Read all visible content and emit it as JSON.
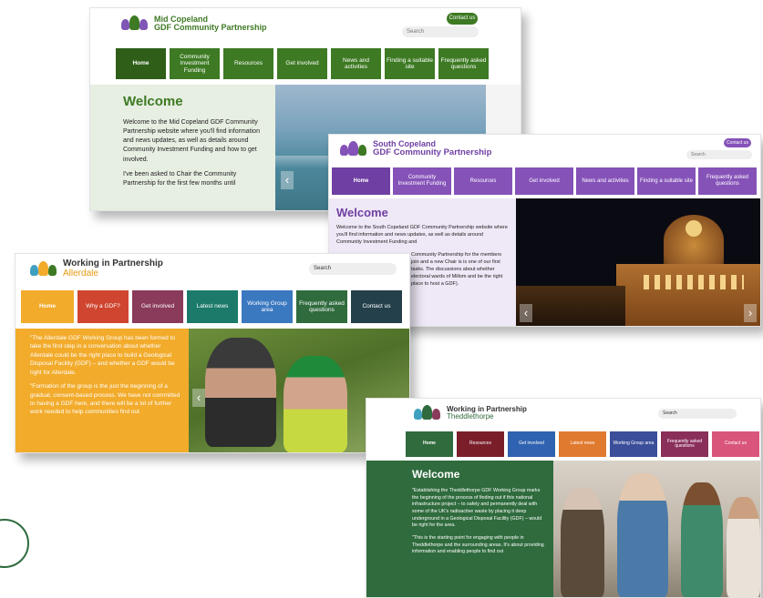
{
  "mid": {
    "line1": "Mid Copeland",
    "line2": "GDF Community Partnership",
    "contact": "Contact us",
    "search": "Search",
    "nav": [
      "Home",
      "Community Investment Funding",
      "Resources",
      "Get involved",
      "News and activities",
      "Finding a suitable site",
      "Frequently asked questions"
    ],
    "heading": "Welcome",
    "p1": "Welcome to the Mid Copeland GDF Community Partnership website where you'll find information and news updates, as well as details around Community Investment Funding and how to get involved.",
    "p2": "I've been asked to Chair the Community Partnership for the first few months until",
    "colors": {
      "nav": "#3d7a23",
      "panel": "#e7eee2",
      "heading": "#3d7a23"
    }
  },
  "south": {
    "line1": "South Copeland",
    "line2": "GDF Community Partnership",
    "contact": "Contact us",
    "search": "Search",
    "nav": [
      "Home",
      "Community Investment Funding",
      "Resources",
      "Get involved",
      "News and activities",
      "Finding a suitable site",
      "Frequently asked questions"
    ],
    "heading": "Welcome",
    "p1": "Welcome to the South Copeland GDF Community Partnership website where you'll find information and news updates, as well as details around Community Investment Funding and",
    "p2": "Community Partnership for the members join and a new Chair is is one of our first tasks. The discussions about whether electoral wards of Millom and be the right place to host a GDF).",
    "colors": {
      "nav": "#8552b8",
      "panel": "#efe8f6",
      "heading": "#6f3fa3"
    }
  },
  "allerdale": {
    "line1": "Working in Partnership",
    "line2": "Allerdale",
    "search": "Search",
    "nav": [
      "Home",
      "Why a GDF?",
      "Get involved",
      "Latest news",
      "Working Group area",
      "Frequently asked questions",
      "Contact us"
    ],
    "p1": "\"The Allerdale GDF Working Group has been formed to take the first step in a conversation about whether Allerdale could be the right place to build a Geological Disposal Facility (GDF) – and whether a GDF would be right for Allerdale.",
    "p2": "\"Formation of the group is the just the beginning of a gradual, consent-based process. We have not committed to having a GDF here, and there will be a lot of further work needed to help communities find out",
    "colors": {
      "panel": "#f2ab2b",
      "text": "#fff"
    }
  },
  "theddle": {
    "line1": "Working in Partnership",
    "line2": "Theddlethorpe",
    "search": "Search",
    "nav": [
      "Home",
      "Resources",
      "Get involved",
      "Latest news",
      "Working Group area",
      "Frequently asked questions",
      "Contact us"
    ],
    "heading": "Welcome",
    "p1": "\"Establishing the Theddlethorpe GDF Working Group marks the beginning of the process of finding out if this national infrastructure project – to safely and permanently deal with some of the UK's radioactive waste by placing it deep underground in a Geological Disposal Facility (GDF) – would be right for the area.",
    "p2": "\"This is the starting point for engaging with people in Theddlethorpe and the surrounding areas. It's about providing information and enabling people to find out",
    "colors": {
      "panel": "#2f6b3d"
    }
  }
}
